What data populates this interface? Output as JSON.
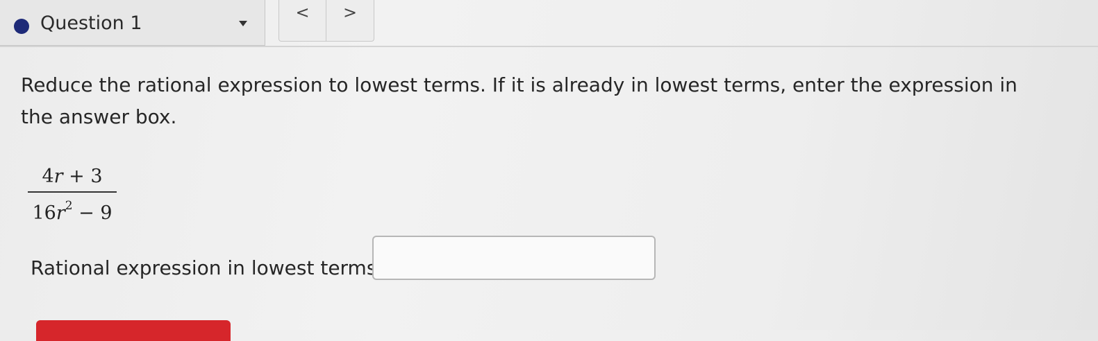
{
  "header": {
    "question_title": "Question 1",
    "status_color": "#1e2a78",
    "prev_symbol": "<",
    "next_symbol": ">",
    "icons": {
      "dropdown": "caret-down-icon",
      "status": "status-dot-icon"
    }
  },
  "question": {
    "prompt": "Reduce the rational expression to lowest terms. If it is already in lowest terms, enter the expression in the answer box.",
    "expression": {
      "numerator": {
        "coef": "4",
        "var": "r",
        "op": " + ",
        "const": "3"
      },
      "denominator": {
        "coef": "16",
        "var": "r",
        "exp": "2",
        "op": " − ",
        "const": "9"
      }
    },
    "answer_label": "Rational expression in lowest terms:",
    "answer_value": ""
  },
  "colors": {
    "accent_button": "#d6262b"
  }
}
